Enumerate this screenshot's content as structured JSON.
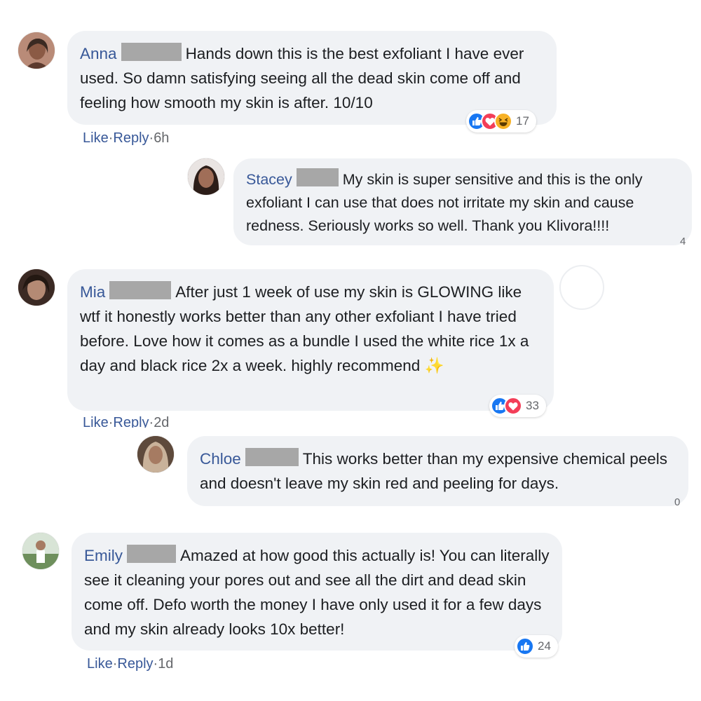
{
  "comments": [
    {
      "name": "Anna",
      "text": "Hands down this is the best exfoliant I have ever used. So damn satisfying seeing all the dead skin come off and feeling how smooth my skin is after. 10/10",
      "actions": {
        "like": "Like",
        "reply": "Reply",
        "time": "6h"
      },
      "reactions": {
        "icons": [
          "like-icon",
          "love-icon",
          "haha-icon"
        ],
        "count": "17"
      },
      "avatar_color": "#c99a86"
    },
    {
      "name": "Stacey",
      "text": "My skin is super sensitive and this is the only exfoliant I can use that does not irritate my skin and cause redness. Seriously works so well. Thank you Klivora!!!!",
      "count": "4",
      "avatar_color": "#6e5148"
    },
    {
      "name": "Mia",
      "text": "After just 1 week of use my skin is GLOWING like wtf it honestly works better than any other exfoliant I have tried before. Love how it comes as a bundle I used the white rice 1x a day and black rice 2x a week. highly recommend",
      "emoji": "✨",
      "actions": {
        "like": "Like",
        "reply": "Reply",
        "time": "2d"
      },
      "reactions": {
        "icons": [
          "like-icon",
          "love-icon"
        ],
        "count": "33"
      },
      "avatar_color": "#8a6a58"
    },
    {
      "name": "Chloe",
      "text": "This works better than my expensive chemical peels and doesn't leave my skin red and peeling for days.",
      "count": "0",
      "avatar_color": "#7a6250"
    },
    {
      "name": "Emily",
      "text": "Amazed at how good this actually is! You can literally see it cleaning your pores out and see all the dirt and dead skin come off. Defo worth the money I have only used it for a few days and my skin already looks 10x better!",
      "actions": {
        "like": "Like",
        "reply": "Reply",
        "time": "1d"
      },
      "reactions": {
        "icons": [
          "like-icon"
        ],
        "count": "24"
      },
      "avatar_color": "#7f9b83"
    }
  ],
  "colors": {
    "bubble": "#f0f2f5",
    "name": "#385898",
    "like_blue": "#1877f2",
    "love_red": "#f33e58",
    "haha_yellow": "#f7b125",
    "redaction": "#a7a7a7"
  },
  "separator": "·"
}
